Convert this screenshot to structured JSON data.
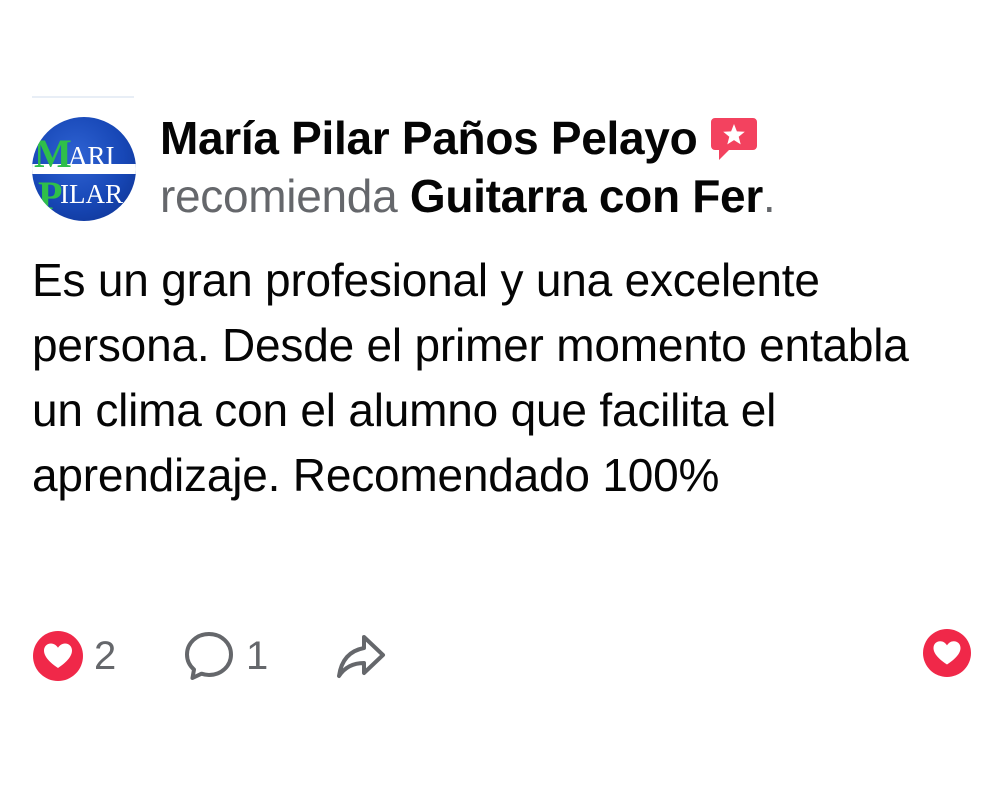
{
  "post": {
    "author": "María Pilar Paños Pelayo",
    "verb": "recomienda",
    "page_name": "Guitarra con Fer",
    "period": ".",
    "text": "Es un gran profesional y una excelente persona. Desde el primer momento entabla un clima con el alumno que facilita el aprendizaje. Recomendado 100%"
  },
  "avatar": {
    "logo_line1": "ARI",
    "logo_line2": "ILAR",
    "icon": "brand-logo"
  },
  "actions": {
    "like_count": "2",
    "comment_count": "1",
    "like_icon": "heart-icon",
    "comment_icon": "comment-bubble-icon",
    "share_icon": "share-arrow-icon"
  },
  "colors": {
    "heart_red": "#f02849",
    "badge_pink": "#f3425f",
    "secondary_text": "#65676b",
    "primary_text": "#050505",
    "avatar_blue": "#1747b6",
    "logo_green": "#2fbf4a"
  }
}
